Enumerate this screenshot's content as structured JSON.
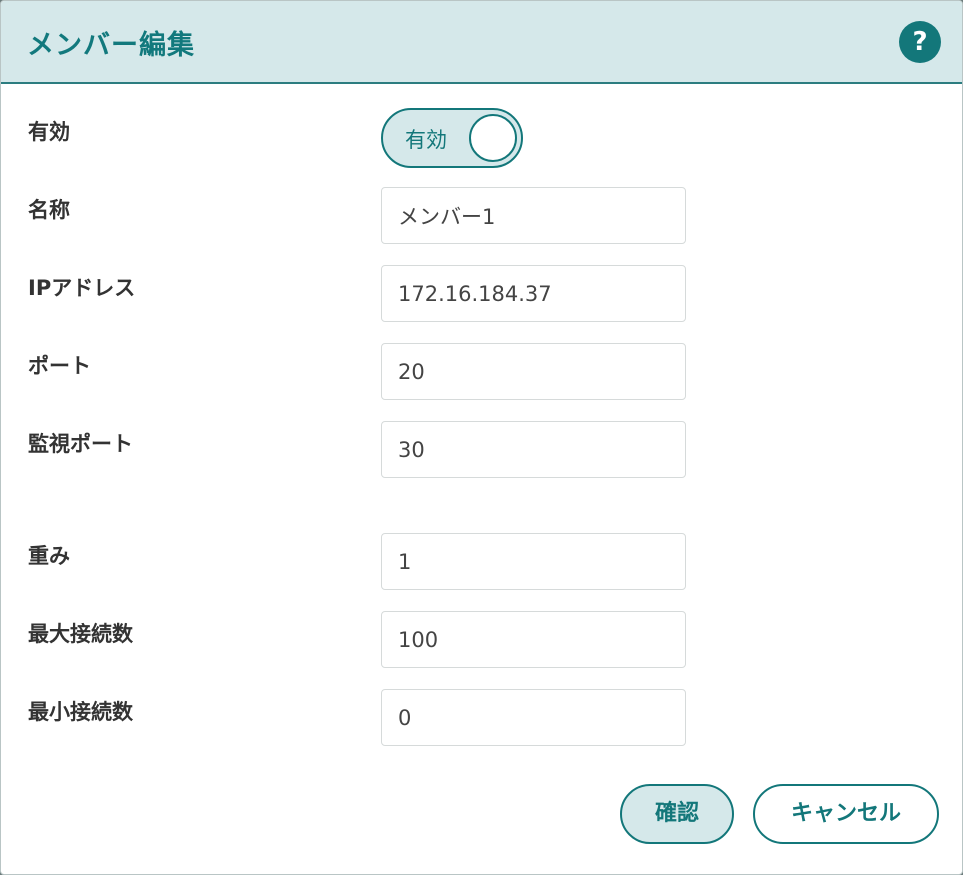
{
  "dialog": {
    "title": "メンバー編集",
    "help_label": "?"
  },
  "form": {
    "enabled": {
      "label": "有効",
      "toggle_text": "有効",
      "state": true
    },
    "name": {
      "label": "名称",
      "value": "メンバー1"
    },
    "ip": {
      "label": "IPアドレス",
      "value": "172.16.184.37"
    },
    "port": {
      "label": "ポート",
      "value": "20"
    },
    "monitor_port": {
      "label": "監視ポート",
      "value": "30"
    },
    "weight": {
      "label": "重み",
      "value": "1"
    },
    "max_conn": {
      "label": "最大接続数",
      "value": "100"
    },
    "min_conn": {
      "label": "最小接続数",
      "value": "0"
    }
  },
  "footer": {
    "confirm_label": "確認",
    "cancel_label": "キャンセル"
  },
  "colors": {
    "accent": "#13777a",
    "header_bg": "#d5e8ea"
  }
}
